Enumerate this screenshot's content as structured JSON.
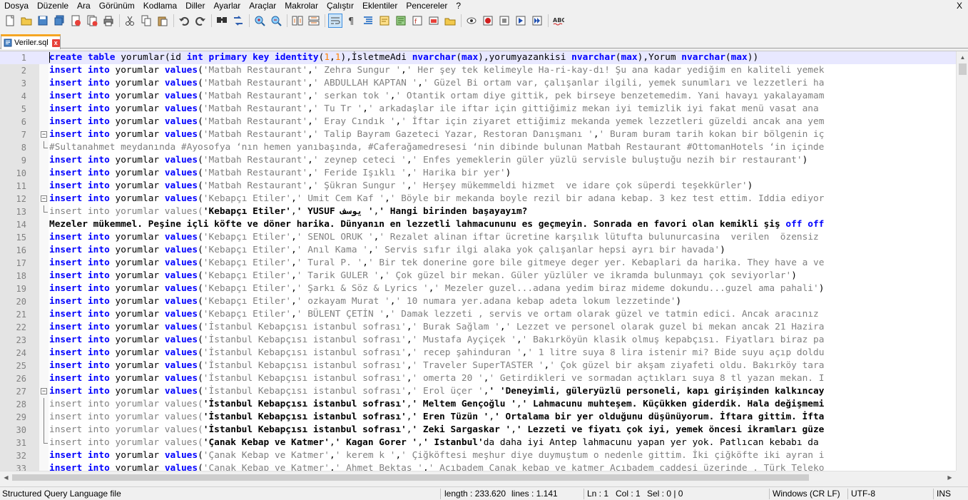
{
  "menu": [
    "Dosya",
    "Düzenle",
    "Ara",
    "Görünüm",
    "Kodlama",
    "Diller",
    "Ayarlar",
    "Araçlar",
    "Makrolar",
    "Çalıştır",
    "Eklentiler",
    "Pencereler",
    "?"
  ],
  "menu_close": "X",
  "toolbar": {
    "icons": [
      "new-file-icon",
      "open-file-icon",
      "save-icon",
      "save-all-icon",
      "close-icon",
      "close-all-icon",
      "print-icon",
      "cut-icon",
      "copy-icon",
      "paste-icon",
      "undo-icon",
      "redo-icon",
      "find-icon",
      "replace-icon",
      "zoom-in-icon",
      "zoom-out-icon",
      "sync-vertical-icon",
      "sync-horizontal-icon",
      "word-wrap-icon",
      "show-all-chars-icon",
      "indent-guide-icon",
      "user-lang-icon",
      "doc-map-icon",
      "function-list-icon",
      "folder-workspace-icon",
      "monitor-icon",
      "record-macro-icon",
      "stop-record-icon",
      "play-macro-icon",
      "run-macro-multiple-icon",
      "save-macro-icon",
      "spellcheck-icon"
    ],
    "spellcheck_label": "ABC"
  },
  "tab": {
    "label": "Veriler.sql",
    "close": "x"
  },
  "editor": {
    "lines": [
      {
        "n": "1",
        "fold": "",
        "html": "<span class=\"kw\">create</span> <span class=\"kw\">table</span> yorumlar(id <span class=\"kw\">int</span> <span class=\"kw\">primary</span> <span class=\"kw\">key</span> <span class=\"kw\">identity</span>(<span class=\"num\">1</span>,<span class=\"num\">1</span>),İsletmeAdi <span class=\"kw\">nvarchar</span>(<span class=\"kw\">max</span>),yorumyazankisi <span class=\"kw\">nvarchar</span>(<span class=\"kw\">max</span>),Yorum <span class=\"kw\">nvarchar</span>(<span class=\"kw\">max</span>))"
      },
      {
        "n": "2",
        "fold": "",
        "html": "<span class=\"kw\">insert</span> <span class=\"kw\">into</span> yorumlar <span class=\"kw\">values</span>(<span class=\"str\">'Matbah Restaurant'</span>,<span class=\"str\">' Zehra Sungur '</span>,<span class=\"str\">' Her şey tek kelimeyle Ha-ri-kay-dı! Şu ana kadar yediğim en kaliteli yemek</span>"
      },
      {
        "n": "3",
        "fold": "",
        "html": "<span class=\"kw\">insert</span> <span class=\"kw\">into</span> yorumlar <span class=\"kw\">values</span>(<span class=\"str\">'Matbah Restaurant'</span>,<span class=\"str\">' ABDULLAH KAPTAN '</span>,<span class=\"str\">' Güzel Bi ortam var, çalışanlar ilgili, yemek sunumları ve lezzetleri ha</span>"
      },
      {
        "n": "4",
        "fold": "",
        "html": "<span class=\"kw\">insert</span> <span class=\"kw\">into</span> yorumlar <span class=\"kw\">values</span>(<span class=\"str\">'Matbah Restaurant'</span>,<span class=\"str\">' serkan tok '</span>,<span class=\"str\">' Otantik ortam diye gittik, pek birseye benzetemedim. Yani havayı yakalayamam</span>"
      },
      {
        "n": "5",
        "fold": "",
        "html": "<span class=\"kw\">insert</span> <span class=\"kw\">into</span> yorumlar <span class=\"kw\">values</span>(<span class=\"str\">'Matbah Restaurant'</span>,<span class=\"str\">' Tu Tr '</span>,<span class=\"str\">' arkadaşlar ile iftar için gittiğimiz mekan iyi temizlik iyi fakat menü vasat ana</span>"
      },
      {
        "n": "6",
        "fold": "",
        "html": "<span class=\"kw\">insert</span> <span class=\"kw\">into</span> yorumlar <span class=\"kw\">values</span>(<span class=\"str\">'Matbah Restaurant'</span>,<span class=\"str\">' Eray Cındık '</span>,<span class=\"str\">' İftar için ziyaret ettiğimiz mekanda yemek lezzetleri güzeldi ancak ana yem</span>"
      },
      {
        "n": "7",
        "fold": "open",
        "html": "<span class=\"kw\">insert</span> <span class=\"kw\">into</span> yorumlar <span class=\"kw\">values</span>(<span class=\"str\">'Matbah Restaurant'</span>,<span class=\"str\">' Talip Bayram Gazeteci Yazar, Restoran Danışmanı '</span>,<span class=\"str\">' Buram buram tarih kokan bir bölgenin iç</span>"
      },
      {
        "n": "8",
        "fold": "end",
        "html": "<span class=\"str\">#Sultanahmet meydanında #Ayosofya ‘nın hemen yanıbaşında, #Caferağamedresesi ‘nin dibinde bulunan Matbah Restaurant #OttomanHotels ‘in içinde</span>"
      },
      {
        "n": "9",
        "fold": "",
        "html": "<span class=\"kw\">insert</span> <span class=\"kw\">into</span> yorumlar <span class=\"kw\">values</span>(<span class=\"str\">'Matbah Restaurant'</span>,<span class=\"str\">' zeynep ceteci '</span>,<span class=\"str\">' Enfes yemeklerin güler yüzlü servisle buluştuğu nezih bir restaurant'</span>)"
      },
      {
        "n": "10",
        "fold": "",
        "html": "<span class=\"kw\">insert</span> <span class=\"kw\">into</span> yorumlar <span class=\"kw\">values</span>(<span class=\"str\">'Matbah Restaurant'</span>,<span class=\"str\">' Feride Işıklı '</span>,<span class=\"str\">' Harika bir yer'</span>)"
      },
      {
        "n": "11",
        "fold": "",
        "html": "<span class=\"kw\">insert</span> <span class=\"kw\">into</span> yorumlar <span class=\"kw\">values</span>(<span class=\"str\">'Matbah Restaurant'</span>,<span class=\"str\">' Şükran Sungur '</span>,<span class=\"str\">' Herşey mükemmeldi hizmet  ve idare çok süperdi teşekkürler'</span>)"
      },
      {
        "n": "12",
        "fold": "open",
        "html": "<span class=\"kw\">insert</span> <span class=\"kw\">into</span> yorumlar <span class=\"kw\">values</span>(<span class=\"str\">'Kebapçı Etiler'</span>,<span class=\"str\">' Umit Cem Kaf '</span>,<span class=\"str\">' Böyle bir mekanda boyle rezil bir adana kebap. 3 kez test ettim. Iddia ediyor</span>"
      },
      {
        "n": "13",
        "fold": "end",
        "html": "<span class=\"str\">insert into yorumlar values(</span><span class=\"bold\">'Kebapçı Etiler'</span>,<span class=\"bold\">' YUSUF يوسف '</span>,<span class=\"bold\">' Hangi birinden başayayım?</span>"
      },
      {
        "n": "14",
        "fold": "",
        "html": "<span class=\"bold\">Mezeler mükemmel. Peşine içli köfte ve döner harika. Dünyanın en lezzetli lahmacununu es geçmeyin. Sonrada en favori olan kemikli şiş </span><span class=\"kw\">off</span> <span class=\"kw\">off</span>"
      },
      {
        "n": "15",
        "fold": "",
        "html": "<span class=\"kw\">insert</span> <span class=\"kw\">into</span> yorumlar <span class=\"kw\">values</span>(<span class=\"str\">'Kebapçı Etiler'</span>,<span class=\"str\">' SENOL ORUK '</span>,<span class=\"str\">' Rezalet alinan iftar ücretine karşılık lütufta bulunurcasina  verilen  özensiz</span>"
      },
      {
        "n": "16",
        "fold": "",
        "html": "<span class=\"kw\">insert</span> <span class=\"kw\">into</span> yorumlar <span class=\"kw\">values</span>(<span class=\"str\">'Kebapçı Etiler'</span>,<span class=\"str\">' Anıl Kama '</span>,<span class=\"str\">' Servis sıfır ilgi alaka yok çalışanlar hepsi ayrı bir havada'</span>)"
      },
      {
        "n": "17",
        "fold": "",
        "html": "<span class=\"kw\">insert</span> <span class=\"kw\">into</span> yorumlar <span class=\"kw\">values</span>(<span class=\"str\">'Kebapçı Etiler'</span>,<span class=\"str\">' Tural P. '</span>,<span class=\"str\">' Bir tek donerine gore bile gitmeye deger yer. Kebaplari da harika. They have a ve</span>"
      },
      {
        "n": "18",
        "fold": "",
        "html": "<span class=\"kw\">insert</span> <span class=\"kw\">into</span> yorumlar <span class=\"kw\">values</span>(<span class=\"str\">'Kebapçı Etiler'</span>,<span class=\"str\">' Tarik GULER '</span>,<span class=\"str\">' Çok güzel bir mekan. Güler yüzlüler ve ikramda bulunmayı çok seviyorlar'</span>)"
      },
      {
        "n": "19",
        "fold": "",
        "html": "<span class=\"kw\">insert</span> <span class=\"kw\">into</span> yorumlar <span class=\"kw\">values</span>(<span class=\"str\">'Kebapçı Etiler'</span>,<span class=\"str\">' Şarkı &amp; Söz &amp; Lyrics '</span>,<span class=\"str\">' Mezeler guzel...adana yedim biraz mideme dokundu...guzel ama pahali'</span>)"
      },
      {
        "n": "20",
        "fold": "",
        "html": "<span class=\"kw\">insert</span> <span class=\"kw\">into</span> yorumlar <span class=\"kw\">values</span>(<span class=\"str\">'Kebapçı Etiler'</span>,<span class=\"str\">' ozkayam Murat '</span>,<span class=\"str\">' 10 numara yer.adana kebap adeta lokum lezzetinde'</span>)"
      },
      {
        "n": "21",
        "fold": "",
        "html": "<span class=\"kw\">insert</span> <span class=\"kw\">into</span> yorumlar <span class=\"kw\">values</span>(<span class=\"str\">'Kebapçı Etiler'</span>,<span class=\"str\">' BÜLENT ÇETİN '</span>,<span class=\"str\">' Damak lezzeti , servis ve ortam olarak güzel ve tatmin edici. Ancak aracınız</span>"
      },
      {
        "n": "22",
        "fold": "",
        "html": "<span class=\"kw\">insert</span> <span class=\"kw\">into</span> yorumlar <span class=\"kw\">values</span>(<span class=\"str\">'İstanbul Kebapçısı istanbul sofrası'</span>,<span class=\"str\">' Burak Sağlam '</span>,<span class=\"str\">' Lezzet ve personel olarak guzel bi mekan ancak 21 Hazira</span>"
      },
      {
        "n": "23",
        "fold": "",
        "html": "<span class=\"kw\">insert</span> <span class=\"kw\">into</span> yorumlar <span class=\"kw\">values</span>(<span class=\"str\">'İstanbul Kebapçısı istanbul sofrası'</span>,<span class=\"str\">' Mustafa Ayçiçek '</span>,<span class=\"str\">' Bakırköyün klasik olmuş kepabçısı. Fiyatları biraz pa</span>"
      },
      {
        "n": "24",
        "fold": "",
        "html": "<span class=\"kw\">insert</span> <span class=\"kw\">into</span> yorumlar <span class=\"kw\">values</span>(<span class=\"str\">'İstanbul Kebapçısı istanbul sofrası'</span>,<span class=\"str\">' recep şahinduran '</span>,<span class=\"str\">' 1 litre suya 8 lira istenir mi? Bide suyu açıp doldu</span>"
      },
      {
        "n": "25",
        "fold": "",
        "html": "<span class=\"kw\">insert</span> <span class=\"kw\">into</span> yorumlar <span class=\"kw\">values</span>(<span class=\"str\">'İstanbul Kebapçısı istanbul sofrası'</span>,<span class=\"str\">' Traveler SuperTASTER '</span>,<span class=\"str\">' Çok güzel bir akşam ziyafeti oldu. Bakırköy tara</span>"
      },
      {
        "n": "26",
        "fold": "",
        "html": "<span class=\"kw\">insert</span> <span class=\"kw\">into</span> yorumlar <span class=\"kw\">values</span>(<span class=\"str\">'İstanbul Kebapçısı istanbul sofrası'</span>,<span class=\"str\">' omerta 20 '</span>,<span class=\"str\">' Getirdikleri ve sormadan açtıkları suya 8 tl yazan mekan. I</span>"
      },
      {
        "n": "27",
        "fold": "open",
        "html": "<span class=\"kw\">insert</span> <span class=\"kw\">into</span> yorumlar <span class=\"kw\">values</span>(<span class=\"str\">'İstanbul Kebapçısı istanbul sofrası'</span>,<span class=\"str\">' Erol üçer '</span>,<span class=\"bold\">' 'Deneyimli, güleryüzlü personeli, kapı girişinden kalkıncay</span>"
      },
      {
        "n": "28",
        "fold": "mid",
        "html": "<span class=\"str\">insert into yorumlar values(</span><span class=\"bold\">'İstanbul Kebapçısı istanbul sofrası'</span>,<span class=\"bold\">' Meltem Gençoğlu '</span>,<span class=\"bold\">' Lahmacunu muhteşem. Küçükken giderdik. Hala değişmemi</span>"
      },
      {
        "n": "29",
        "fold": "mid",
        "html": "<span class=\"str\">insert into yorumlar values(</span><span class=\"bold\">'İstanbul Kebapçısı istanbul sofrası'</span>,<span class=\"bold\">' Eren Tüzün '</span>,<span class=\"bold\">' Ortalama bir yer olduğunu düşünüyorum. İftara gittim. İfta</span>"
      },
      {
        "n": "30",
        "fold": "mid",
        "html": "<span class=\"str\">insert into yorumlar values(</span><span class=\"bold\">'İstanbul Kebapçısı istanbul sofrası'</span>,<span class=\"bold\">' Zeki Sargaskar '</span>,<span class=\"bold\">' Lezzeti ve fiyatı çok iyi, yemek öncesi ikramları güze</span>"
      },
      {
        "n": "31",
        "fold": "end",
        "html": "<span class=\"str\">insert into yorumlar values(</span><span class=\"bold\">'Çanak Kebap ve Katmer'</span>,<span class=\"bold\">' Kagan Gorer '</span>,<span class=\"bold\">' Istanbul'</span>da daha iyi Antep lahmacunu yapan yer yok. Patlıcan kebabı da"
      },
      {
        "n": "32",
        "fold": "",
        "html": "<span class=\"kw\">insert</span> <span class=\"kw\">into</span> yorumlar <span class=\"kw\">values</span>(<span class=\"str\">'Çanak Kebap ve Katmer'</span>,<span class=\"str\">' kerem k '</span>,<span class=\"str\">' Çiğköftesi meşhur diye duymuştum o nedenle gittim. İki çiğköfte iki ayran i</span>"
      },
      {
        "n": "33",
        "fold": "",
        "html": "<span class=\"kw\">insert</span> <span class=\"kw\">into</span> yorumlar <span class=\"kw\">values</span>(<span class=\"str\">'Çanak Kebap ve Katmer'</span>,<span class=\"str\">' Ahmet Bektas '</span>,<span class=\"str\">' Acıbadem Çanak kebap ve katmer Acıbadem caddesi üzerinde . Türk Teleko</span>"
      }
    ]
  },
  "status": {
    "filetype": "Structured Query Language file",
    "length": "length : 233.620",
    "lines": "lines : 1.141",
    "ln": "Ln : 1",
    "col": "Col : 1",
    "sel": "Sel : 0 | 0",
    "eol": "Windows (CR LF)",
    "encoding": "UTF-8",
    "mode": "INS"
  }
}
